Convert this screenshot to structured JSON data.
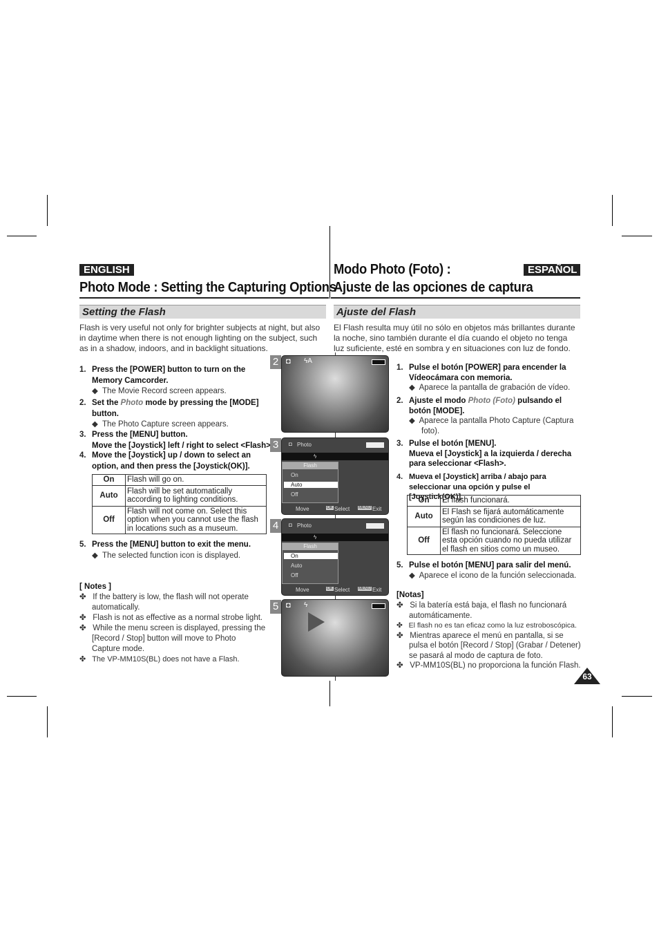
{
  "english": {
    "lang": "ENGLISH",
    "title": "Photo Mode : Setting the Capturing Options",
    "section": "Setting the Flash",
    "intro": "Flash is very useful not only for brighter subjects at night, but also in daytime when there is not enough lighting on the subject, such as in a shadow, indoors, and in backlight situations.",
    "steps": [
      {
        "n": "1.",
        "text": "Press the [POWER] button to turn on the Memory Camcorder.",
        "sub": "The Movie Record screen appears."
      },
      {
        "n": "2.",
        "pre": "Set the ",
        "em": "Photo",
        "post": " mode by pressing the [MODE] button.",
        "sub": "The Photo Capture screen appears."
      },
      {
        "n": "3.",
        "text": "Press the [MENU] button.",
        "text2": "Move the [Joystick] left / right to select <Flash>."
      },
      {
        "n": "4.",
        "text": "Move the [Joystick] up / down to select an option, and then press the [Joystick(OK)]."
      },
      {
        "n": "5.",
        "text": "Press the [MENU] button to exit the menu.",
        "sub": "The selected function icon is displayed."
      }
    ],
    "table": [
      {
        "k": "On",
        "v": "Flash will go on."
      },
      {
        "k": "Auto",
        "v": "Flash will be set automatically according to lighting conditions."
      },
      {
        "k": "Off",
        "v": "Flash will not come on. Select this option when you cannot use the flash in locations such as a museum."
      }
    ],
    "notes_title": "[ Notes ]",
    "notes": [
      "If the battery is low, the flash will not operate automatically.",
      "Flash is not as effective as a normal strobe light.",
      "While the menu screen is displayed, pressing the [Record / Stop] button will move to Photo Capture mode.",
      "The VP-MM10S(BL) does not have a Flash."
    ]
  },
  "espanol": {
    "lang": "ESPAÑOL",
    "title_line1": "Modo Photo (Foto) :",
    "title_line2": "Ajuste de las opciones de captura",
    "section": "Ajuste del Flash",
    "intro": "El Flash resulta muy útil no sólo en objetos más brillantes durante la noche, sino también durante el día cuando el objeto no tenga luz suficiente, esté en sombra y en situaciones con luz de fondo.",
    "steps": [
      {
        "n": "1.",
        "text": "Pulse el botón [POWER] para encender la Vídeocámara con memoria.",
        "sub": "Aparece la pantalla de grabación de vídeo."
      },
      {
        "n": "2.",
        "pre": "Ajuste el modo ",
        "em": "Photo (Foto)",
        "post": " pulsando el botón [MODE].",
        "sub": "Aparece la pantalla Photo Capture (Captura foto)."
      },
      {
        "n": "3.",
        "text": "Pulse el botón [MENU].",
        "text2": "Mueva el [Joystick] a la izquierda / derecha para seleccionar <Flash>."
      },
      {
        "n": "4.",
        "text": "Mueva el [Joystick] arriba / abajo para seleccionar una opción y pulse el [Joystick(OK)]."
      },
      {
        "n": "5.",
        "text": "Pulse el botón [MENU] para salir del menú.",
        "sub": "Aparece el icono de la función seleccionada."
      }
    ],
    "table": [
      {
        "k": "On",
        "v": "El flash funcionará."
      },
      {
        "k": "Auto",
        "v": "El Flash se fijará automáticamente según las condiciones de luz."
      },
      {
        "k": "Off",
        "v": "El flash no funcionará. Seleccione esta opción cuando no pueda utilizar el flash en sitios como un museo."
      }
    ],
    "notes_title": "[Notas]",
    "notes": [
      "Si la batería está baja, el flash no funcionará automáticamente.",
      "El flash no es tan eficaz como la luz estroboscópica.",
      "Mientras aparece el menú en pantalla, si se pulsa el botón [Record / Stop] (Grabar / Detener) se pasará al modo de captura de foto.",
      "VP-MM10S(BL) no proporciona la función Flash."
    ]
  },
  "screens": [
    {
      "badge": "2",
      "type": "photo"
    },
    {
      "badge": "3",
      "type": "menu",
      "title": "Photo",
      "menu_title": "Flash",
      "items": [
        "On",
        "Auto",
        "Off"
      ],
      "selected": "Auto",
      "footer": [
        "Move",
        "Select",
        "Exit"
      ],
      "keys": [
        "OK",
        "MENU"
      ]
    },
    {
      "badge": "4",
      "type": "menu",
      "title": "Photo",
      "menu_title": "Flash",
      "items": [
        "On",
        "Auto",
        "Off"
      ],
      "selected": "On",
      "footer": [
        "Move",
        "Select",
        "Exit"
      ],
      "keys": [
        "OK",
        "MENU"
      ]
    },
    {
      "badge": "5",
      "type": "photo"
    }
  ],
  "page_number": "63"
}
